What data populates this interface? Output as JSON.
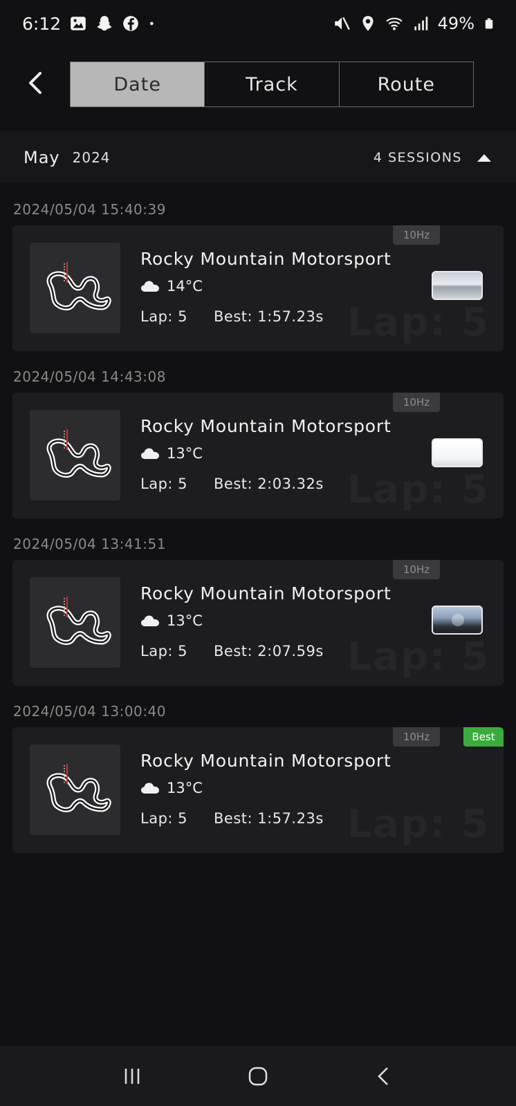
{
  "status_bar": {
    "time": "6:12",
    "battery": "49%",
    "left_icons": [
      "gallery-icon",
      "snapchat-icon",
      "facebook-icon",
      "dot-icon"
    ],
    "right_icons": [
      "mute-icon",
      "location-icon",
      "wifi-icon",
      "signal-icon",
      "battery-icon"
    ]
  },
  "header": {
    "tabs": [
      {
        "label": "Date",
        "active": true
      },
      {
        "label": "Track",
        "active": false
      },
      {
        "label": "Route",
        "active": false
      }
    ]
  },
  "month_header": {
    "month": "May",
    "year": "2024",
    "sessions_label": "4 SESSIONS"
  },
  "sessions": [
    {
      "datetime": "2024/05/04 15:40:39",
      "track": "Rocky Mountain Motorsport",
      "temp": "14°C",
      "lap": "Lap: 5",
      "best": "Best: 1:57.23s",
      "hz": "10Hz",
      "badge": "",
      "watermark": "Lap: 5"
    },
    {
      "datetime": "2024/05/04 14:43:08",
      "track": "Rocky Mountain Motorsport",
      "temp": "13°C",
      "lap": "Lap: 5",
      "best": "Best: 2:03.32s",
      "hz": "10Hz",
      "badge": "",
      "watermark": "Lap: 5"
    },
    {
      "datetime": "2024/05/04 13:41:51",
      "track": "Rocky Mountain Motorsport",
      "temp": "13°C",
      "lap": "Lap: 5",
      "best": "Best: 2:07.59s",
      "hz": "10Hz",
      "badge": "",
      "watermark": "Lap: 5"
    },
    {
      "datetime": "2024/05/04 13:00:40",
      "track": "Rocky Mountain Motorsport",
      "temp": "13°C",
      "lap": "Lap: 5",
      "best": "Best: 1:57.23s",
      "hz": "10Hz",
      "badge": "Best",
      "watermark": "Lap: 5"
    }
  ],
  "colors": {
    "background": "#111012",
    "card": "#1d1d20",
    "active_tab": "#b7b7b7",
    "best_badge": "#3bab3e"
  }
}
